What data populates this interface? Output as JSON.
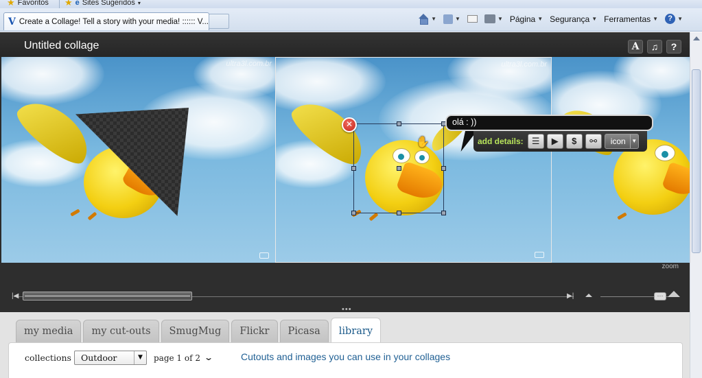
{
  "browser": {
    "favorites_label": "Favoritos",
    "suggested_sites_label": "Sites Sugeridos",
    "more_glyph": "»",
    "tab_title": "Create a Collage! Tell a story with your media! :::::: V...",
    "tools": {
      "page": "Página",
      "security": "Segurança",
      "tools": "Ferramentas",
      "help": "?"
    }
  },
  "app": {
    "title": "Untitled collage",
    "toolbar": {
      "text_btn": "A",
      "music_btn": "♫",
      "help_btn": "?"
    },
    "watermark": "ultra3l.com.br",
    "speech_bubble": {
      "text": "olá : ))",
      "add_details_label": "add details:",
      "icon_select": "icon"
    },
    "timeline": {
      "zoom_label": "zoom"
    },
    "library": {
      "tabs": [
        "my media",
        "my cut-outs",
        "SmugMug",
        "Flickr",
        "Picasa",
        "library"
      ],
      "active_tab": "library",
      "collections_label": "collections",
      "collection_value": "Outdoor",
      "page_text": "page 1 of 2",
      "description": "Cutouts and images you can use in your collages"
    }
  },
  "colors": {
    "app_bg": "#2b2b2b",
    "accent_green": "#b7e35a",
    "link_blue": "#1f5f93",
    "delete_red": "#c6241a"
  }
}
